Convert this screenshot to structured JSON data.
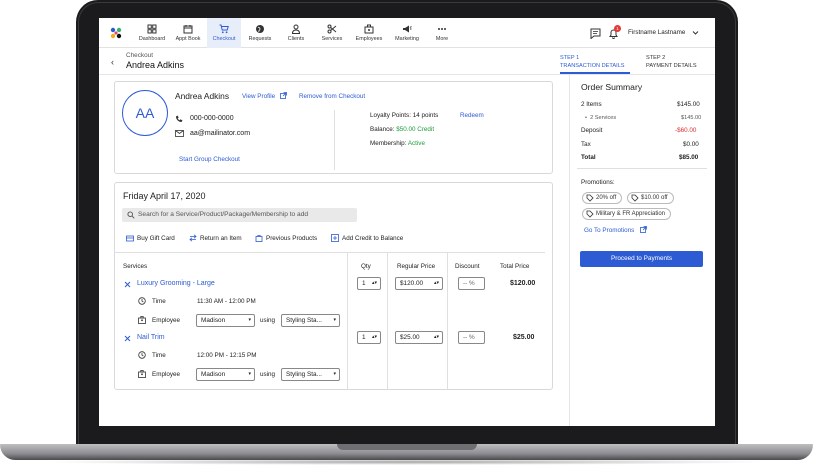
{
  "nav": {
    "items": [
      {
        "label": "Dashboard",
        "icon": "dashboard-icon"
      },
      {
        "label": "Appt Book",
        "icon": "calendar-icon"
      },
      {
        "label": "Checkout",
        "icon": "cart-icon"
      },
      {
        "label": "Requests",
        "icon": "globe-icon"
      },
      {
        "label": "Clients",
        "icon": "person-icon"
      },
      {
        "label": "Services",
        "icon": "scissors-icon"
      },
      {
        "label": "Employees",
        "icon": "briefcase-icon"
      },
      {
        "label": "Marketing",
        "icon": "megaphone-icon"
      },
      {
        "label": "More",
        "icon": "more-icon"
      }
    ],
    "user_name": "Firstname Lastname",
    "notification_count": "1"
  },
  "header": {
    "breadcrumb": "Checkout",
    "client_name": "Andrea Adkins",
    "step1_label": "STEP 1",
    "step1_name": "TRANSACTION DETAILS",
    "step2_label": "STEP 2",
    "step2_name": "PAYMENT DETAILS"
  },
  "client": {
    "initials": "AA",
    "name": "Andrea Adkins",
    "view_profile": "View Profile",
    "remove": "Remove from Checkout",
    "phone": "000-000-0000",
    "email": "aa@mailinator.com",
    "group_checkout": "Start Group Checkout",
    "loyalty_label": "Loyalty Points: 14 points",
    "redeem": "Redeem",
    "balance_label": "Balance:",
    "balance_value": "$50.00 Credit",
    "membership_label": "Membership:",
    "membership_value": "Active"
  },
  "checkout": {
    "date": "Friday April 17, 2020",
    "search_placeholder": "Search for a Service/Product/Package/Membership to add",
    "actions": [
      "Buy Gift Card",
      "Return an Item",
      "Previous Products",
      "Add Credit to Balance"
    ],
    "columns": [
      "Services",
      "Qty",
      "Regular Price",
      "Discount",
      "Total Price"
    ],
    "time_label": "Time",
    "employee_label": "Employee",
    "using_label": "using",
    "services": [
      {
        "name": "Luxury Grooming - Large",
        "qty": "1",
        "price": "$120.00",
        "discount": "-- %",
        "total": "$120.00",
        "time": "11:30 AM - 12:00 PM",
        "employee": "Madison",
        "station": "Styling Sta..."
      },
      {
        "name": "Nail Trim",
        "qty": "1",
        "price": "$25.00",
        "discount": "-- %",
        "total": "$25.00",
        "time": "12:00 PM - 12:15 PM",
        "employee": "Madison",
        "station": "Styling Sta..."
      }
    ]
  },
  "summary": {
    "title": "Order Summary",
    "rows": [
      {
        "label": "2 Items",
        "value": "$145.00"
      },
      {
        "label": "2 Services",
        "value": "$145.00"
      },
      {
        "label": "Deposit",
        "value": "-$60.00"
      },
      {
        "label": "Tax",
        "value": "$0.00"
      },
      {
        "label": "Total",
        "value": "$85.00"
      }
    ],
    "promotions_label": "Promotions:",
    "promos": [
      "20% off",
      "$10.00 off",
      "Military & FR Appreciation"
    ],
    "goto_promotions": "Go To Promotions",
    "proceed": "Proceed to Payments",
    "colors": {
      "accent": "#2d5bd3",
      "negative": "#d32f2f",
      "positive": "#1e9b3a"
    }
  }
}
